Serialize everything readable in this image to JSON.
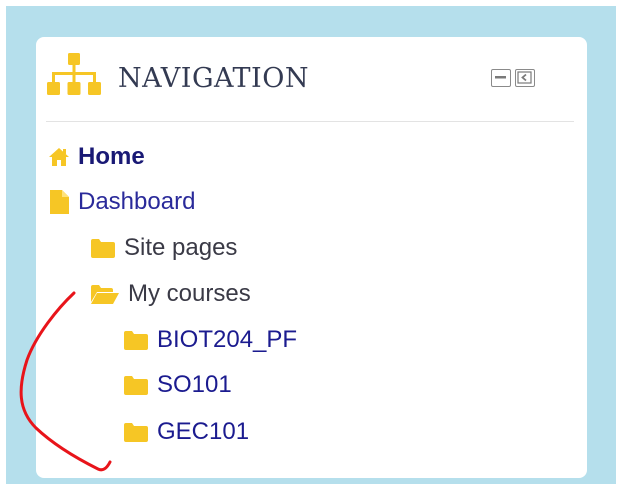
{
  "block": {
    "title": "NAVIGATION",
    "icon": "sitemap-icon",
    "controls": [
      {
        "name": "minimize-icon",
        "label": "Minimize block"
      },
      {
        "name": "dock-icon",
        "label": "Dock block"
      }
    ]
  },
  "nav": {
    "home": {
      "label": "Home",
      "icon": "home-icon"
    },
    "dashboard": {
      "label": "Dashboard",
      "icon": "file-icon"
    },
    "site_pages": {
      "label": "Site pages",
      "icon": "folder-icon"
    },
    "my_courses": {
      "label": "My courses",
      "icon": "folder-open-icon"
    },
    "courses": [
      {
        "label": "BIOT204_PF",
        "icon": "folder-icon"
      },
      {
        "label": "SO101",
        "icon": "folder-icon"
      },
      {
        "label": "GEC101",
        "icon": "folder-icon"
      }
    ]
  },
  "colors": {
    "background": "#b5dfec",
    "icon": "#f6c625",
    "link": "#1b1b8f",
    "annotation": "#e8141a"
  }
}
